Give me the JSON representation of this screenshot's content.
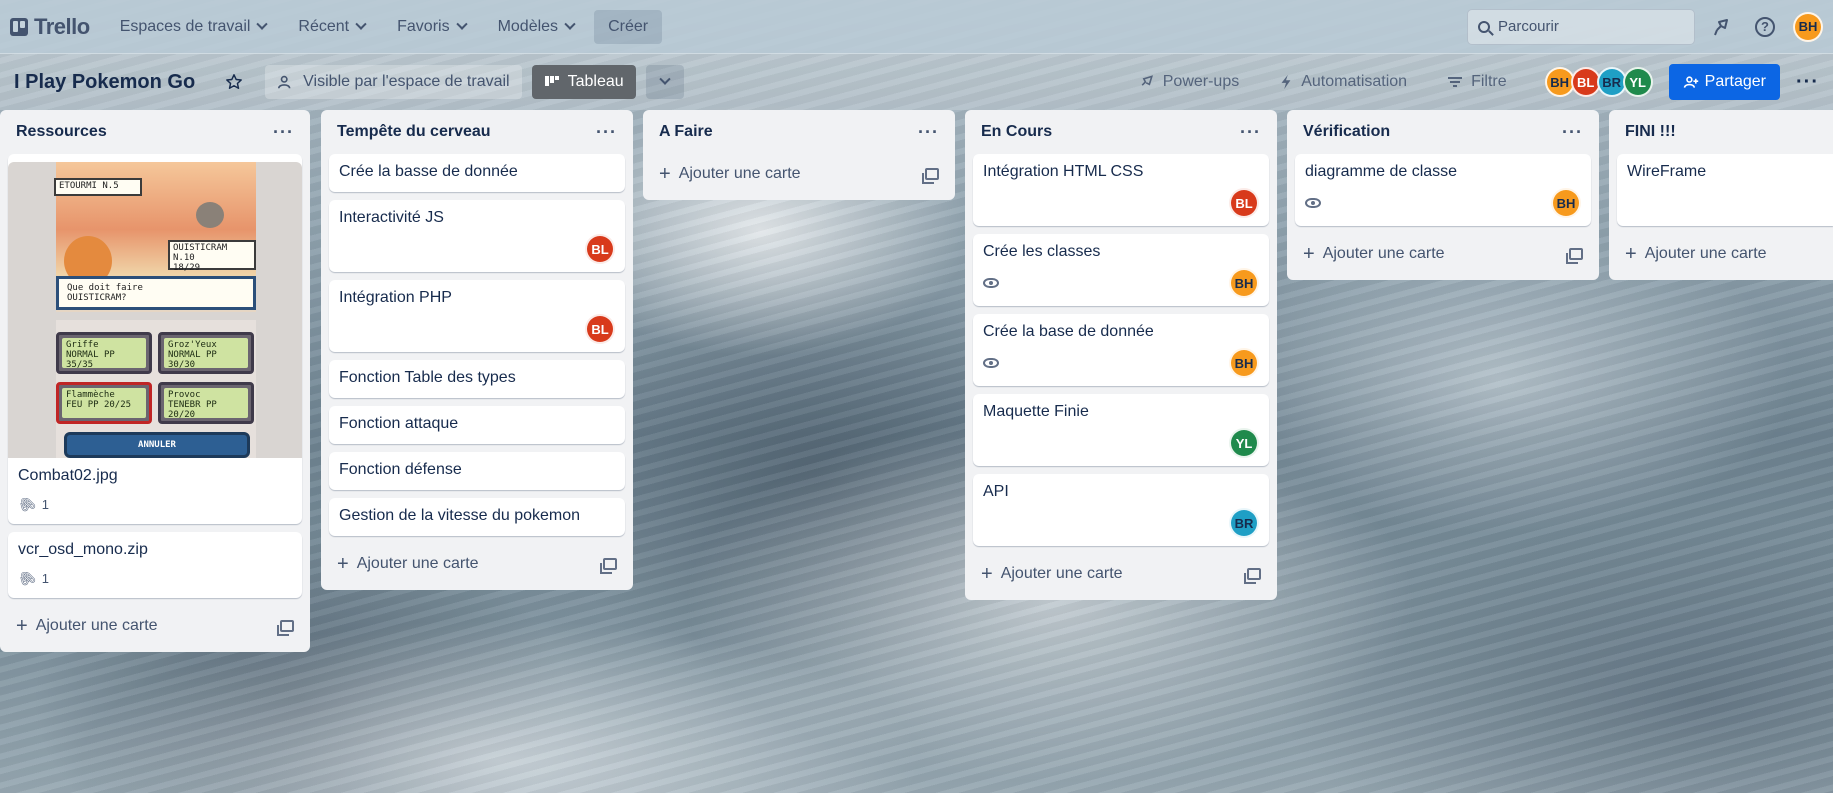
{
  "topnav": {
    "logo": "Trello",
    "menus": [
      "Espaces de travail",
      "Récent",
      "Favoris",
      "Modèles"
    ],
    "create": "Créer",
    "search_placeholder": "Parcourir",
    "user_initials": "BH"
  },
  "board": {
    "title": "I Play Pokemon Go",
    "visibility": "Visible par l'espace de travail",
    "view": "Tableau",
    "powerups": "Power-ups",
    "automation": "Automatisation",
    "filter": "Filtre",
    "members": [
      "BH",
      "BL",
      "BR",
      "YL"
    ],
    "share": "Partager"
  },
  "add_card_label": "Ajouter une carte",
  "cover": {
    "enemy_name": "ETOURMI",
    "enemy_level": "N.5",
    "player_name": "OUISTICRAM",
    "player_level": "N.10",
    "player_hp": "18/29",
    "prompt_line1": "Que doit faire",
    "prompt_line2": "OUISTICRAM?",
    "moves": [
      {
        "name": "Griffe",
        "type": "NORMAL",
        "pp": "PP 35/35"
      },
      {
        "name": "Groz'Yeux",
        "type": "NORMAL",
        "pp": "PP 30/30"
      },
      {
        "name": "Flammèche",
        "type": "FEU",
        "pp": "PP 20/25"
      },
      {
        "name": "Provoc",
        "type": "TENEBR",
        "pp": "PP 20/20"
      }
    ],
    "cancel": "ANNULER"
  },
  "lists": [
    {
      "title": "Ressources",
      "cards": [
        {
          "title": "Combat02.jpg",
          "attachments": "1"
        },
        {
          "title": "vcr_osd_mono.zip",
          "attachments": "1"
        }
      ]
    },
    {
      "title": "Tempête du cerveau",
      "cards": [
        {
          "title": "Crée la basse de donnée"
        },
        {
          "title": "Interactivité JS",
          "member": "BL"
        },
        {
          "title": "Intégration PHP",
          "member": "BL"
        },
        {
          "title": "Fonction Table des types"
        },
        {
          "title": "Fonction attaque"
        },
        {
          "title": "Fonction défense"
        },
        {
          "title": "Gestion de la vitesse du pokemon"
        }
      ]
    },
    {
      "title": "A Faire",
      "cards": []
    },
    {
      "title": "En Cours",
      "cards": [
        {
          "title": "Intégration HTML CSS",
          "member": "BL"
        },
        {
          "title": "Crée les classes",
          "member": "BH",
          "watching": true
        },
        {
          "title": "Crée la base de donnée",
          "member": "BH",
          "watching": true
        },
        {
          "title": "Maquette Finie",
          "member": "YL"
        },
        {
          "title": "API",
          "member": "BR"
        }
      ]
    },
    {
      "title": "Vérification",
      "cards": [
        {
          "title": "diagramme de classe",
          "member": "BH",
          "watching": true
        }
      ]
    },
    {
      "title": "FINI !!!",
      "cards": [
        {
          "title": "WireFrame"
        }
      ]
    }
  ]
}
